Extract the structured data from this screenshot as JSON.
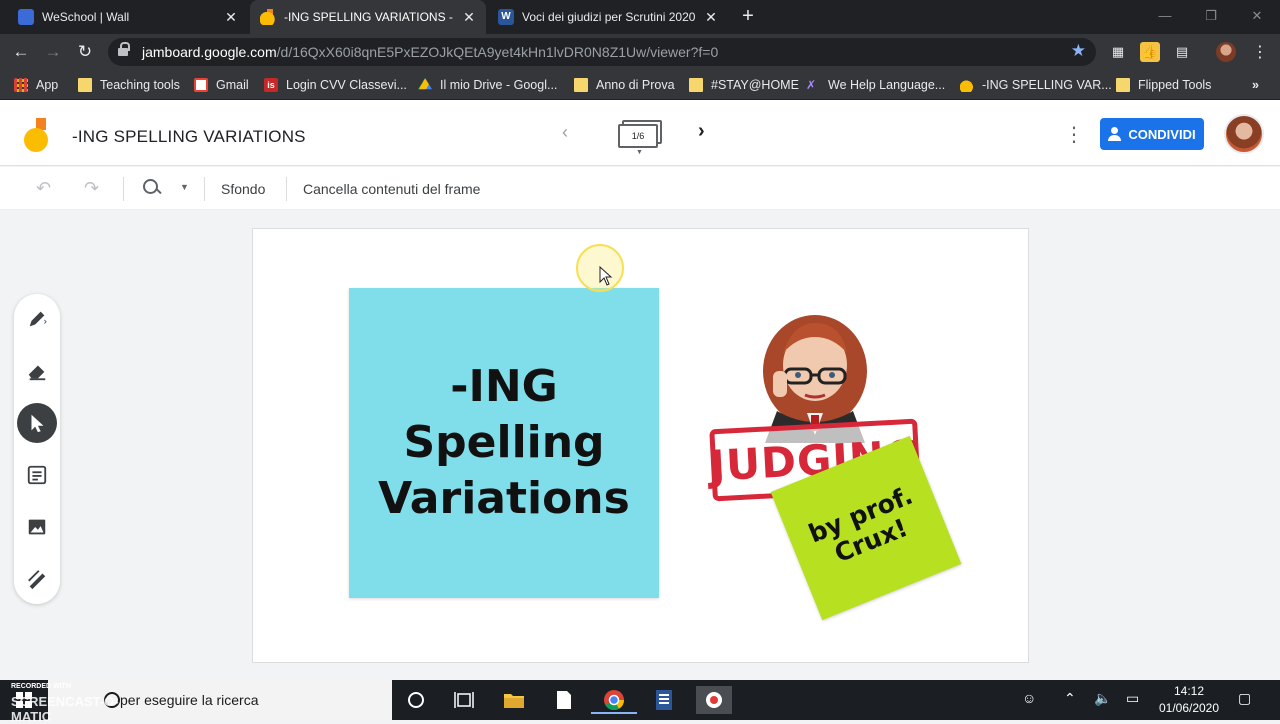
{
  "browser": {
    "tabs": [
      {
        "title": "WeSchool | Wall",
        "close": "✕"
      },
      {
        "title": "-ING SPELLING VARIATIONS - Go",
        "close": "✕"
      },
      {
        "title": "Voci dei giudizi per Scrutini 2020",
        "close": "✕"
      }
    ],
    "new_tab": "+",
    "url_host": "jamboard.google.com",
    "url_path": "/d/16QxX60i8qnE5PxEZOJkQEtA9yet4kHn1lvDR0N8Z1Uw/viewer?f=0",
    "bookmarks": [
      "App",
      "Teaching tools",
      "Gmail",
      "Login CVV Classevi...",
      "Il mio Drive - Googl...",
      "Anno di Prova",
      "#STAY@HOME",
      "We Help Language...",
      "-ING SPELLING VAR...",
      "Flipped Tools"
    ],
    "more_bookmarks": "»"
  },
  "jamboard": {
    "title": "-ING SPELLING VARIATIONS",
    "frame_indicator": "1/6",
    "share_label": "CONDIVIDI",
    "toolbar": {
      "background_label": "Sfondo",
      "clear_label": "Cancella contenuti del frame"
    },
    "sticky_note": "-ING\nSpelling\nVariations",
    "stamp_text": "JUDGING",
    "green_note": "by prof.\nCrux!"
  },
  "taskbar": {
    "search_placeholder": "per eseguire la ricerca",
    "watermark_small": "RECORDED WITH",
    "watermark_big": "SCREENCAST-O-MATIC",
    "time": "14:12",
    "date": "01/06/2020"
  },
  "colors": {
    "sticky_cyan": "#80deea",
    "sticky_green": "#b7e021",
    "stamp_red": "#d7283a",
    "share_blue": "#1a73e8"
  }
}
